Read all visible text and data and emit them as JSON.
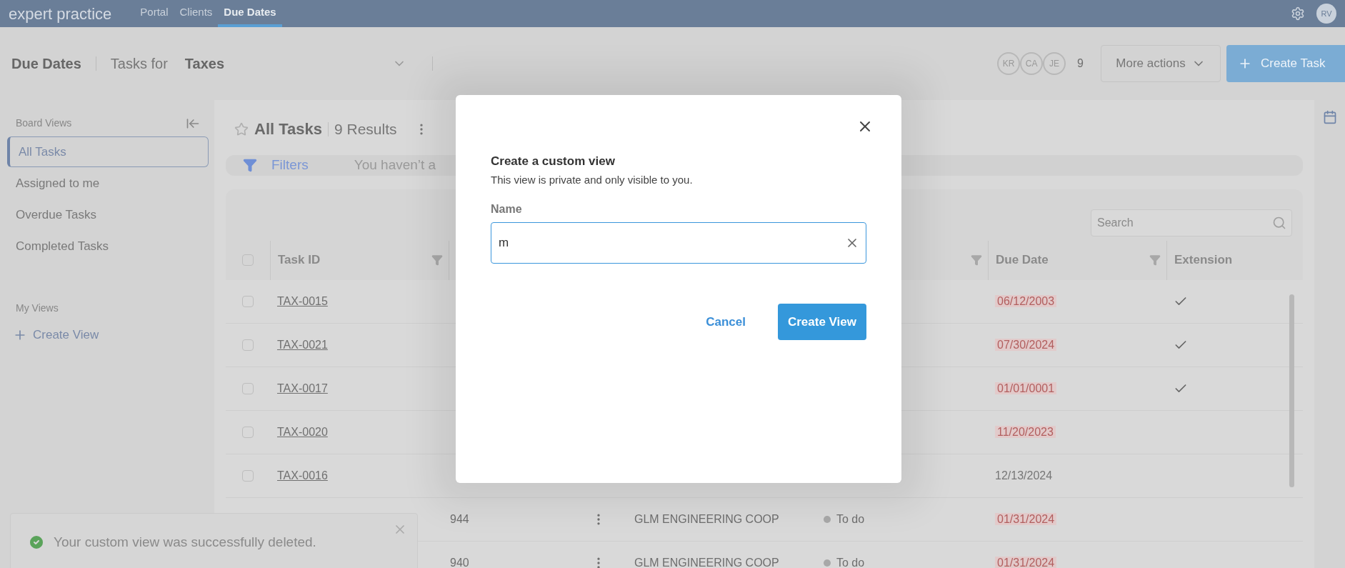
{
  "top_nav": {
    "logo": "expert practice",
    "links": [
      {
        "label": "Portal",
        "selected": false
      },
      {
        "label": "Clients",
        "selected": false
      },
      {
        "label": "Due Dates",
        "selected": true
      }
    ],
    "user_initials": "RV"
  },
  "header": {
    "title": "Due Dates",
    "tasks_for_label": "Tasks for",
    "board": "Taxes",
    "assignees": [
      "KR",
      "CA",
      "JE"
    ],
    "assignee_count": "9",
    "more_actions": "More actions",
    "create_task": "Create Task"
  },
  "sidebar": {
    "board_views_title": "Board Views",
    "board_views": [
      {
        "label": "All Tasks",
        "selected": true
      },
      {
        "label": "Assigned to me",
        "selected": false
      },
      {
        "label": "Overdue Tasks",
        "selected": false
      },
      {
        "label": "Completed Tasks",
        "selected": false
      }
    ],
    "my_views_title": "My Views",
    "create_view": "Create View"
  },
  "board": {
    "title": "All Tasks",
    "results": "9 Results",
    "filters_label": "Filters",
    "filters_message": "You haven’t a",
    "search": {
      "placeholder": "Search"
    },
    "select_all_checked": false,
    "columns": [
      {
        "label": "Task ID"
      },
      {
        "label": "Due Date"
      },
      {
        "label": "Extension"
      }
    ],
    "rows": [
      {
        "checked": false,
        "task_id": "TAX-0015",
        "due_date": "06/12/2003",
        "overdue": true,
        "extension": true
      },
      {
        "checked": false,
        "task_id": "TAX-0021",
        "due_date": "07/30/2024",
        "overdue": true,
        "extension": true
      },
      {
        "checked": false,
        "task_id": "TAX-0017",
        "due_date": "01/01/0001",
        "overdue": true,
        "extension": true
      },
      {
        "checked": false,
        "task_id": "TAX-0020",
        "due_date": "11/20/2023",
        "overdue": true,
        "extension": false
      },
      {
        "checked": false,
        "task_id": "TAX-0016",
        "due_date": "12/13/2024",
        "overdue": false,
        "extension": false
      },
      {
        "column_2": "944",
        "client": "GLM ENGINEERING COOP",
        "status": "To do",
        "due_date": "01/31/2024",
        "overdue": true,
        "extension": false
      },
      {
        "column_2": "940",
        "client": "GLM ENGINEERING COOP",
        "status": "To do",
        "due_date": "01/31/2024",
        "overdue": true,
        "extension": false
      }
    ]
  },
  "dialog": {
    "title": "Create a custom view",
    "subtitle": "This view is private and only visible to you.",
    "name_label": "Name",
    "name_value": "m",
    "cancel": "Cancel",
    "submit": "Create View"
  },
  "toast": {
    "message": "Your custom view was successfully deleted."
  }
}
